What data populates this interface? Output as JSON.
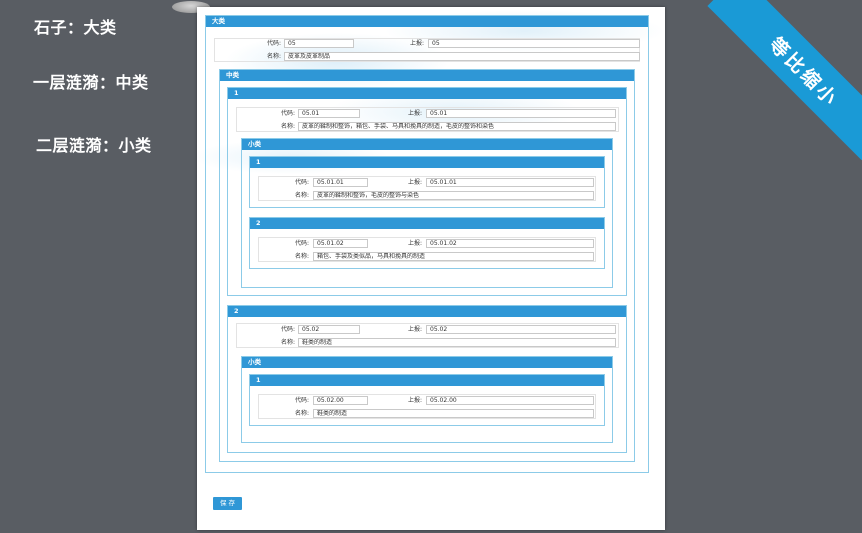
{
  "annotations": {
    "line1": "石子：大类",
    "line2": "一层涟漪：中类",
    "line3": "二层涟漪：小类"
  },
  "ribbon": "等比缩小",
  "labels": {
    "code": "代码:",
    "report": "上报:",
    "name": "名称:"
  },
  "big": {
    "title": "大类",
    "code": "05",
    "report": "05",
    "name": "皮革及皮革制品"
  },
  "medium": {
    "title": "中类",
    "items": [
      {
        "index": "1",
        "code": "05.01",
        "report": "05.01",
        "name": "皮革的鞣制和整饰，箱包、手袋、马具和挽具的制造，毛皮的整饰和染色"
      },
      {
        "index": "2",
        "code": "05.02",
        "report": "05.02",
        "name": "鞋类的制造"
      }
    ]
  },
  "small": {
    "title": "小类",
    "group1": [
      {
        "index": "1",
        "code": "05.01.01",
        "report": "05.01.01",
        "name": "皮革的鞣制和整饰，毛皮的整饰与染色"
      },
      {
        "index": "2",
        "code": "05.01.02",
        "report": "05.01.02",
        "name": "箱包、手袋及类似品，马具和挽具的制造"
      }
    ],
    "group2": [
      {
        "index": "1",
        "code": "05.02.00",
        "report": "05.02.00",
        "name": "鞋类的制造"
      }
    ]
  },
  "save_label": "保 存",
  "colors": {
    "accent": "#2f97d6",
    "background": "#595d63",
    "ribbon": "#1a9ad6"
  }
}
